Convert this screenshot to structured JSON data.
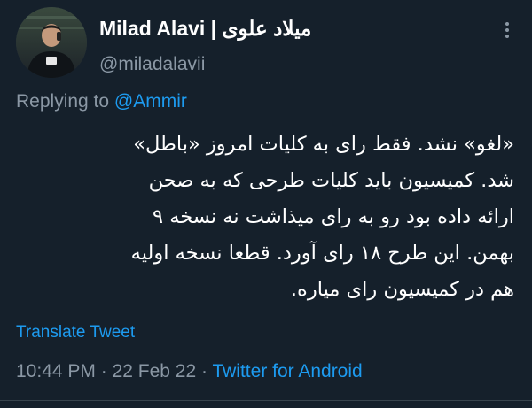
{
  "tweet": {
    "author": {
      "display_name": "Milad Alavi | میلاد علوی",
      "handle": "@miladalavii"
    },
    "more_icon": "more-dots-icon",
    "replying": {
      "prefix": "Replying to",
      "mention": "@Ammir"
    },
    "body_lines": [
      "«لغو» نشد. فقط رای به کلیات امروز «باطل»",
      "شد. کمیسیون باید کلیات طرحی که به صحن",
      "ارائه داده بود رو به رای میذاشت نه نسخه ۹",
      "بهمن. این طرح ۱۸ رای آورد. قطعا نسخه اولیه",
      "هم در کمیسیون رای میاره."
    ],
    "translate_label": "Translate Tweet",
    "time": "10:44 PM",
    "date": "22 Feb 22",
    "separator": "·",
    "source": "Twitter for Android"
  },
  "colors": {
    "background": "#15202b",
    "text": "#ffffff",
    "secondary": "#8b98a5",
    "accent": "#1d9bf0",
    "divider": "#38444d"
  }
}
